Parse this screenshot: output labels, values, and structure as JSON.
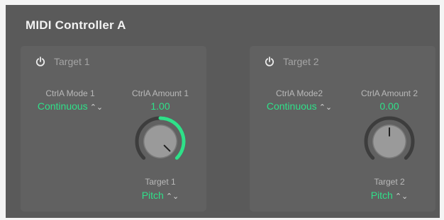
{
  "panel": {
    "title": "MIDI Controller A"
  },
  "targets": [
    {
      "title": "Target 1",
      "mode_label": "CtrlA Mode 1",
      "mode_value": "Continuous",
      "amount_label": "CtrlA Amount 1",
      "amount_value": "1.00",
      "amount_fraction": 1.0,
      "target_label": "Target 1",
      "target_value": "Pitch"
    },
    {
      "title": "Target 2",
      "mode_label": "CtrlA Mode2",
      "mode_value": "Continuous",
      "amount_label": "CtrlA Amount 2",
      "amount_value": "0.00",
      "amount_fraction": 0.5,
      "target_label": "Target 2",
      "target_value": "Pitch"
    }
  ],
  "colors": {
    "accent": "#2fe089",
    "panel_bg": "#5a5a5a",
    "group_bg": "#616161",
    "label": "#b9b9b9"
  },
  "icons": {
    "power": "power-icon",
    "stepper": "up-down-chevron-icon"
  }
}
